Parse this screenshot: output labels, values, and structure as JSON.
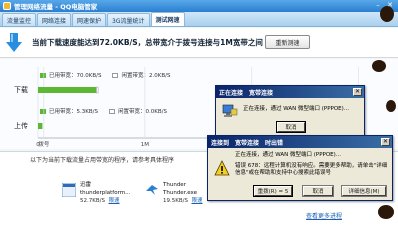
{
  "window": {
    "title": "管理网络流量 - QQ电脑管家"
  },
  "tabs": [
    {
      "label": "流量监控",
      "active": false
    },
    {
      "label": "网络连接",
      "active": false
    },
    {
      "label": "网速保护",
      "active": false
    },
    {
      "label": "3G流量统计",
      "active": false
    },
    {
      "label": "测试网速",
      "active": true
    }
  ],
  "banner": {
    "speed_text": "当前下载速度能达到72.0KB/S，总带宽介于拨号连接与1M宽带之间",
    "retest_label": "重新测速"
  },
  "chart_data": {
    "type": "bar",
    "orientation": "horizontal",
    "categories": [
      "下载",
      "上传"
    ],
    "series": [
      {
        "name": "已用带宽",
        "values": [
          70.0,
          5.3
        ]
      },
      {
        "name": "闲置带宽",
        "values": [
          2.0,
          0.0
        ]
      }
    ],
    "legend_items": [
      {
        "used": "已用带宽：70.0KB/S",
        "idle": "闲置带宽：2.0KB/S"
      },
      {
        "used": "已用带宽：5.3KB/S",
        "idle": "闲置带宽：0.0KB/S"
      }
    ],
    "x_ticks": [
      "0",
      "拨号",
      "1M",
      "2M",
      "3M"
    ],
    "x_tick_values_kbps": [
      0,
      7,
      128,
      256,
      384
    ],
    "xlim": [
      0,
      400
    ],
    "color_used": "#5cb832",
    "color_idle": "#ffffff"
  },
  "process_area": {
    "note": "以下为当前下载流量占用带宽的程序，请参考具体程序",
    "items": [
      {
        "name": "迅雷",
        "subtitle": "thunderplatform...",
        "speed": "52.7KB/S",
        "limit_label": "限速",
        "icon": "thunder-bolt-icon"
      },
      {
        "name": "Thunder",
        "subtitle": "Thunder.exe",
        "speed": "19.5KB/S",
        "limit_label": "限速",
        "icon": "thunder-bird-icon"
      }
    ],
    "more_label": "查看更多进程"
  },
  "dialog_small": {
    "title": "正在连接",
    "title2": "宽带连接",
    "message": "正在连接，通过 WAN 微型端口 (PPPOE)...",
    "cancel_label": "取消"
  },
  "dialog_error": {
    "title": "连接到",
    "title2": "宽带连接",
    "title3": "时出错",
    "status": "正在连接，通过 WAN 微型端口 (PPPOE)...",
    "error_line1": "错误 678：远程计算机没有响应。需要更多帮助，请单击\"详细",
    "error_line2": "信息\"或在帮助和支持中心搜索此错误号",
    "redial_label": "重拨(R) = 5",
    "cancel_label": "取消",
    "details_label": "详细信息(M)"
  }
}
